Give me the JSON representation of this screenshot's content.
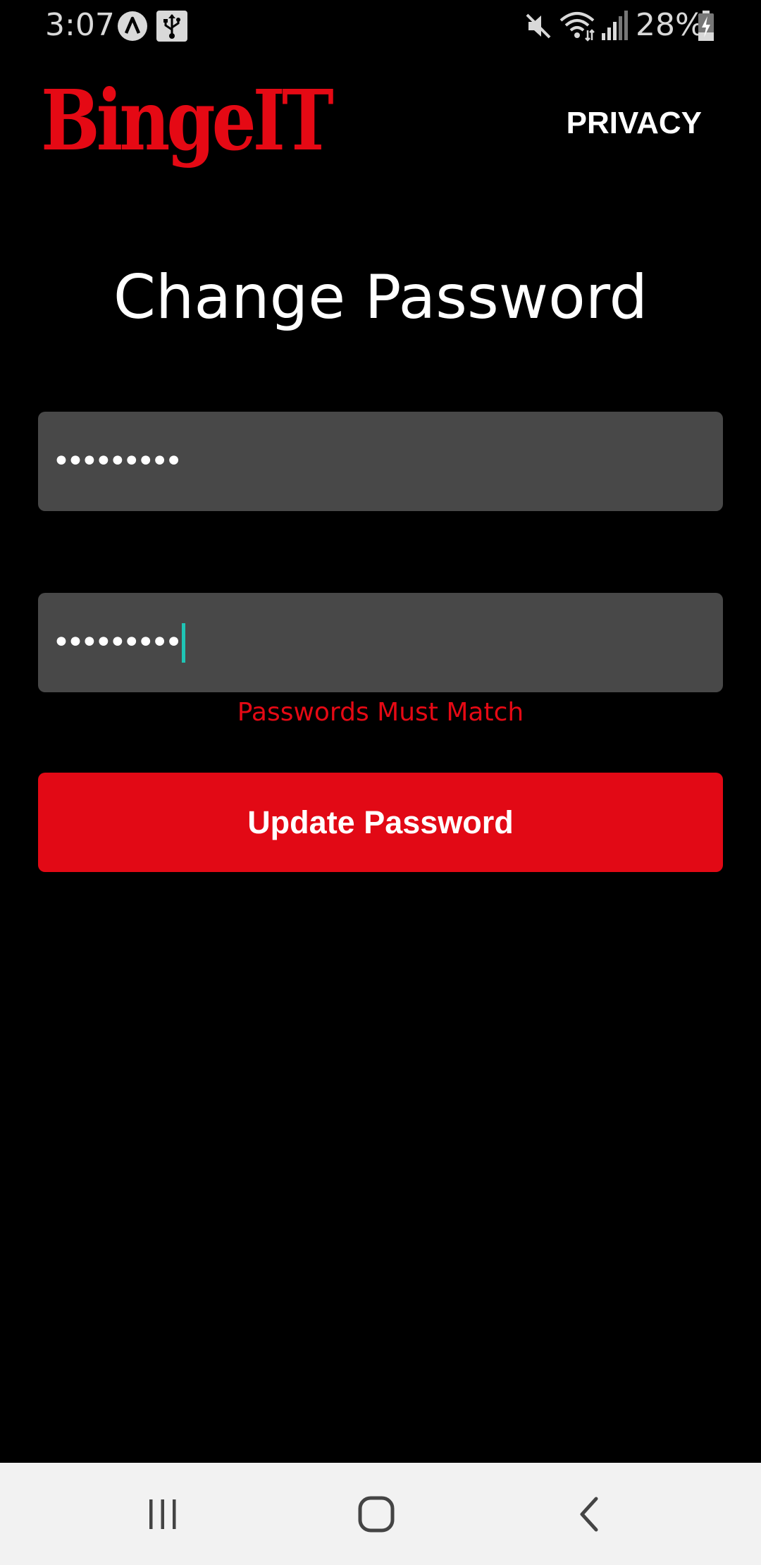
{
  "status_bar": {
    "time": "3:07",
    "battery": "28%",
    "icons": [
      "android-auto-icon",
      "usb-icon",
      "mute-icon",
      "wifi-icon",
      "signal-icon",
      "battery-charging-icon"
    ]
  },
  "header": {
    "logo": "BingeIT",
    "privacy_label": "PRIVACY"
  },
  "main": {
    "title": "Change Password",
    "new_password_value": "•••••••••",
    "confirm_password_value": "•••••••••",
    "error_message": "Passwords Must Match",
    "update_button_label": "Update Password"
  },
  "nav_bar": {
    "icons": [
      "recents-icon",
      "home-icon",
      "back-icon"
    ]
  },
  "colors": {
    "background": "#000000",
    "brand_red": "#e50914",
    "field_bg": "#484848",
    "caret": "#1fc5b5",
    "nav_bg": "#f2f2f2"
  }
}
